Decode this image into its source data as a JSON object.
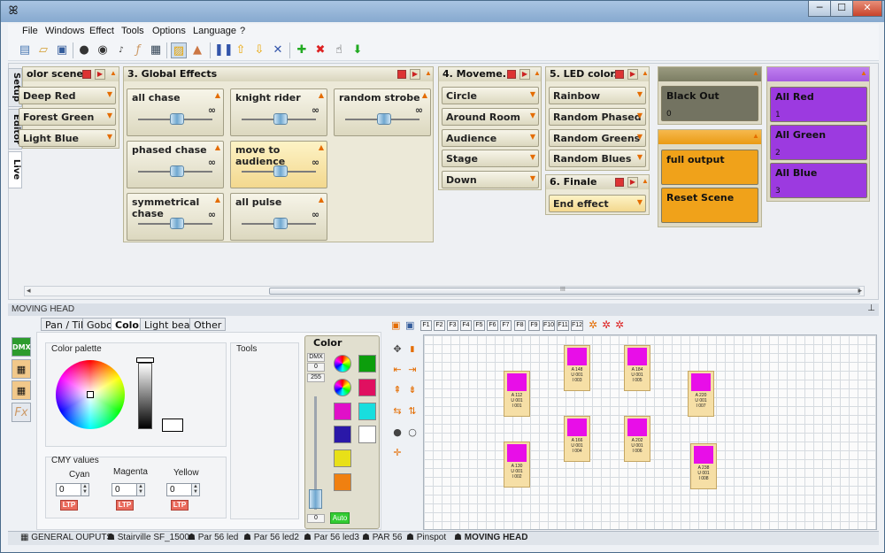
{
  "window": {
    "icon": "qlc-logo",
    "min_label": "─",
    "max_label": "☐",
    "close_label": "✕"
  },
  "menu": [
    "File",
    "Windows",
    "Effect",
    "Tools",
    "Options",
    "Language",
    "?"
  ],
  "toolbar_icons": [
    "new-icon",
    "open-icon",
    "save-icon",
    "blackout-icon",
    "dmx-dump-icon",
    "bpm-icon",
    "effects-icon",
    "monitor-icon",
    "live-mode-icon",
    "edit-mode-icon",
    "pause-icon",
    "import-icon",
    "export-icon",
    "shuffle-icon",
    "add-icon",
    "delete-icon",
    "hand-icon",
    "download-icon"
  ],
  "side_tabs": {
    "setup": "Setup",
    "editor": "Editor",
    "live": "Live"
  },
  "groups": {
    "color_scenes": {
      "title": "olor scenes",
      "items": [
        "Deep Red",
        "Forest Green",
        "Light Blue"
      ]
    },
    "global_effects": {
      "title": "3. Global Effects",
      "items": [
        "all chase",
        "knight rider",
        "random strobe",
        "phased chase",
        "move to audience",
        "symmetrical chase",
        "all pulse"
      ]
    },
    "movements": {
      "title": "4. Moveme...",
      "items": [
        "Circle",
        "Around Room",
        "Audience",
        "Stage",
        "Down"
      ]
    },
    "led_colors": {
      "title": "5. LED color...",
      "items": [
        "Rainbow",
        "Random Phased",
        "Random Greens",
        "Random Blues"
      ]
    },
    "finale": {
      "title": "6. Finale",
      "items": [
        "End effect"
      ]
    }
  },
  "scenes": [
    {
      "label": "Black Out",
      "num": "0",
      "color": "#737361"
    },
    {
      "label": "full output",
      "num": "",
      "color": "#f0a21a"
    },
    {
      "label": "Reset Scene",
      "num": "",
      "color": "#f0a21a"
    },
    {
      "label": "All Red",
      "num": "1",
      "color": "#9c3ae0"
    },
    {
      "label": "All Green",
      "num": "2",
      "color": "#9c3ae0"
    },
    {
      "label": "All Blue",
      "num": "3",
      "color": "#9c3ae0"
    }
  ],
  "scroll_grip": "III",
  "lower": {
    "title": "MOVING HEAD",
    "pin": "⊥",
    "tabs": [
      "Pan / Tilt",
      "Gobo",
      "Color",
      "Light beam",
      "Other"
    ],
    "selected_tab": "Color",
    "nav": [
      "DMX",
      "",
      "",
      "Fx"
    ],
    "color_palette_label": "Color palette",
    "tools_label": "Tools",
    "cmy": {
      "label": "CMY values",
      "cyan": {
        "label": "Cyan",
        "value": "0"
      },
      "magenta": {
        "label": "Magenta",
        "value": "0"
      },
      "yellow": {
        "label": "Yellow",
        "value": "0"
      },
      "ltp": "LTP"
    },
    "color_panel": {
      "title": "Color",
      "dmx_label": "DMX",
      "dmx_value": "0",
      "top_value": "255",
      "bottom_value": "0",
      "auto": "Auto",
      "swatches": [
        "#0c9e0c",
        "#e01060",
        "#e010c8",
        "#18dede",
        "#2a18a8",
        "#ffffff",
        "#e8e018",
        "#f08010"
      ]
    }
  },
  "monitor": {
    "fkeys": [
      "F1",
      "F2",
      "F3",
      "F4",
      "F5",
      "F6",
      "F7",
      "F8",
      "F9",
      "F10",
      "F11",
      "F12"
    ],
    "fixtures": [
      {
        "a": "A 112",
        "u": "U 001",
        "i": "I 001"
      },
      {
        "a": "A 148",
        "u": "U 001",
        "i": "I 003"
      },
      {
        "a": "A 184",
        "u": "U 001",
        "i": "I 005"
      },
      {
        "a": "A 220",
        "u": "U 001",
        "i": "I 007"
      },
      {
        "a": "A 166",
        "u": "U 001",
        "i": "I 004"
      },
      {
        "a": "A 202",
        "u": "U 001",
        "i": "I 006"
      },
      {
        "a": "A 130",
        "u": "U 001",
        "i": "I 002"
      },
      {
        "a": "A 238",
        "u": "U 001",
        "i": "I 008"
      }
    ]
  },
  "bottom_tabs": [
    "GENERAL OUPUTS",
    "Stairville SF_1500",
    "Par 56 led",
    "Par 56 led2",
    "Par 56 led3",
    "PAR 56",
    "Pinspot",
    "MOVING HEAD"
  ],
  "bottom_selected": "MOVING HEAD"
}
